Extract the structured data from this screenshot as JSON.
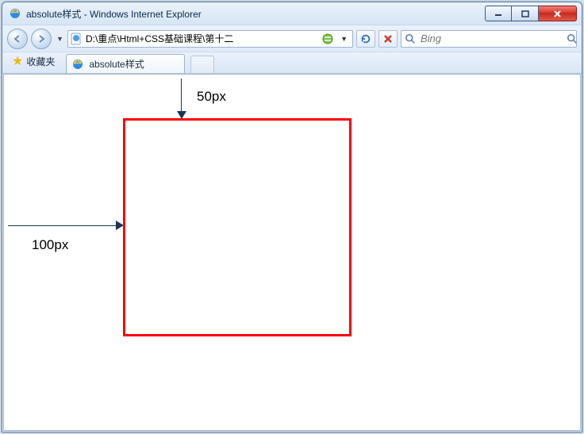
{
  "title": "absolute样式 - Windows Internet Explorer",
  "window_controls": {
    "min": "—",
    "max": "▭",
    "close": "✕"
  },
  "address": {
    "url": "D:\\重点\\Html+CSS基础课程\\第十二"
  },
  "search": {
    "placeholder": "Bing"
  },
  "favorites_label": "收藏夹",
  "tab_label": "absolute样式",
  "annotations": {
    "top_offset": "50px",
    "left_offset": "100px"
  }
}
